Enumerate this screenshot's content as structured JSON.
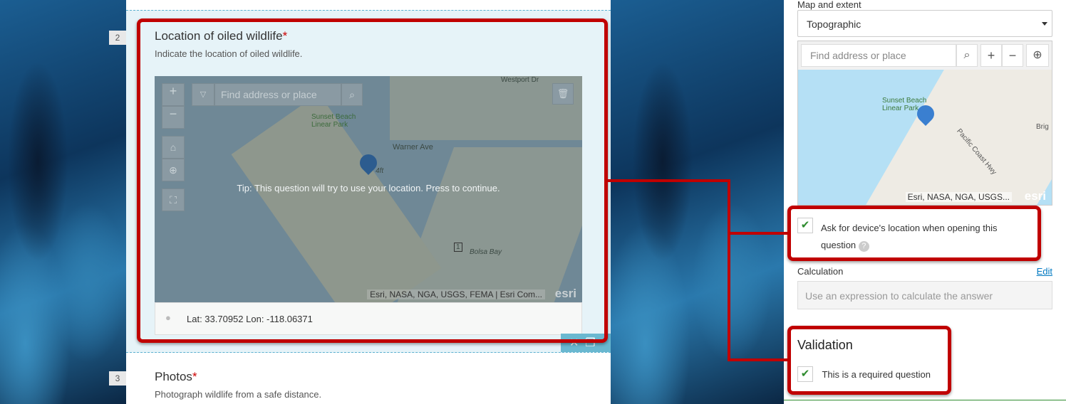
{
  "form": {
    "q2": {
      "number": "2",
      "title": "Location of oiled wildlife",
      "required_mark": "*",
      "description": "Indicate the location of oiled wildlife.",
      "map": {
        "search_placeholder": "Find address or place",
        "zoom_in": "+",
        "zoom_out": "−",
        "tip": "Tip: This question will try to use your location. Press to continue.",
        "labels": [
          "Westport Dr",
          "Sunset Beach Linear Park",
          "Warner Ave",
          "Bolsa Bay",
          "1",
          "4ft"
        ],
        "attribution": "Esri, NASA, NGA, USGS, FEMA | Esri Com...",
        "logo": "esri"
      },
      "coordinates": "Lat: 33.70952 Lon: -118.06371"
    },
    "q3": {
      "number": "3",
      "title": "Photos",
      "required_mark": "*",
      "description": "Photograph wildlife from a safe distance."
    }
  },
  "panel": {
    "map_section_label": "Map and extent",
    "basemap_selected": "Topographic",
    "map": {
      "search_placeholder": "Find address or place",
      "zoom_in": "+",
      "zoom_out": "−",
      "labels": [
        "Sunset Beach Linear Park",
        "Pacific Coast Hwy",
        "Brig"
      ],
      "attribution": "Esri, NASA, NGA, USGS...",
      "logo": "esri"
    },
    "ask_location_label": "Ask for device's location when opening this question",
    "ask_location_checked": true,
    "calculation_label": "Calculation",
    "calculation_edit": "Edit",
    "calculation_placeholder": "Use an expression to calculate the answer",
    "validation_title": "Validation",
    "required_label": "This is a required question",
    "required_checked": true
  },
  "colors": {
    "callout": "#c00000",
    "accent": "#0079c1",
    "selected_bg": "#e6f3f8",
    "required": "#cc0000"
  }
}
